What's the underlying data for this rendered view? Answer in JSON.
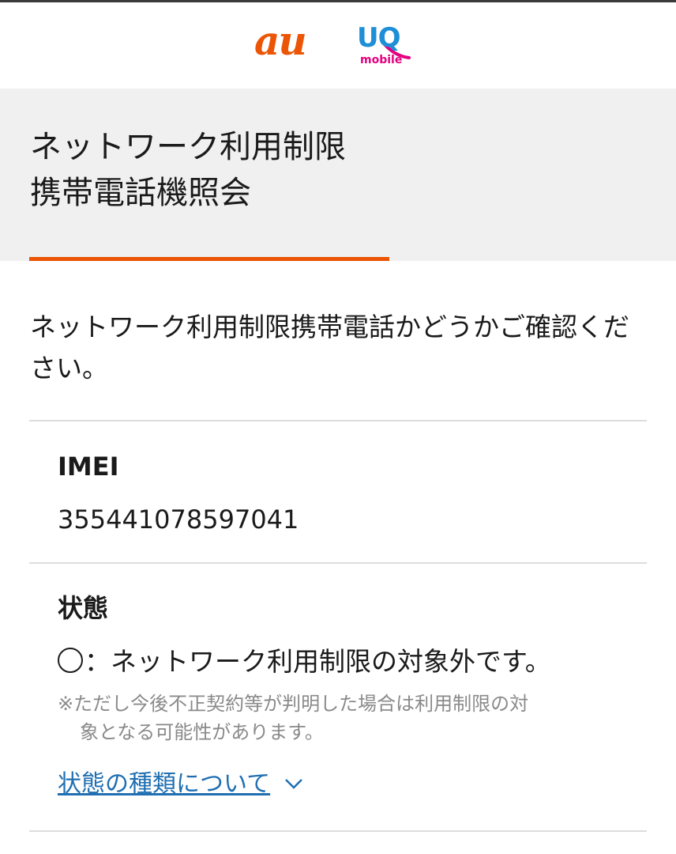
{
  "header": {
    "logo_au": "au",
    "logo_uq": "UQ",
    "logo_uq_sub": "mobile"
  },
  "title": {
    "line1": "ネットワーク利用制限",
    "line2": "携帯電話機照会"
  },
  "intro": "ネットワーク利用制限携帯電話かどうかご確認ください。",
  "imei": {
    "label": "IMEI",
    "value": "355441078597041"
  },
  "status": {
    "label": "状態",
    "mark": "",
    "text": "：ネットワーク利用制限の対象外です。",
    "note_line1": "※ただし今後不正契約等が判明した場合は利用制限の対",
    "note_line2": "象となる可能性があります。",
    "link_label": "状態の種類について"
  },
  "colors": {
    "au_orange": "#eb5505",
    "uq_blue": "#1e8fd6",
    "uq_pink": "#e4007f",
    "link_blue": "#1f6fb2",
    "band_gray": "#f0f0f0"
  },
  "icons": {
    "status_mark": "circle-icon",
    "link_toggle": "chevron-down-icon"
  }
}
